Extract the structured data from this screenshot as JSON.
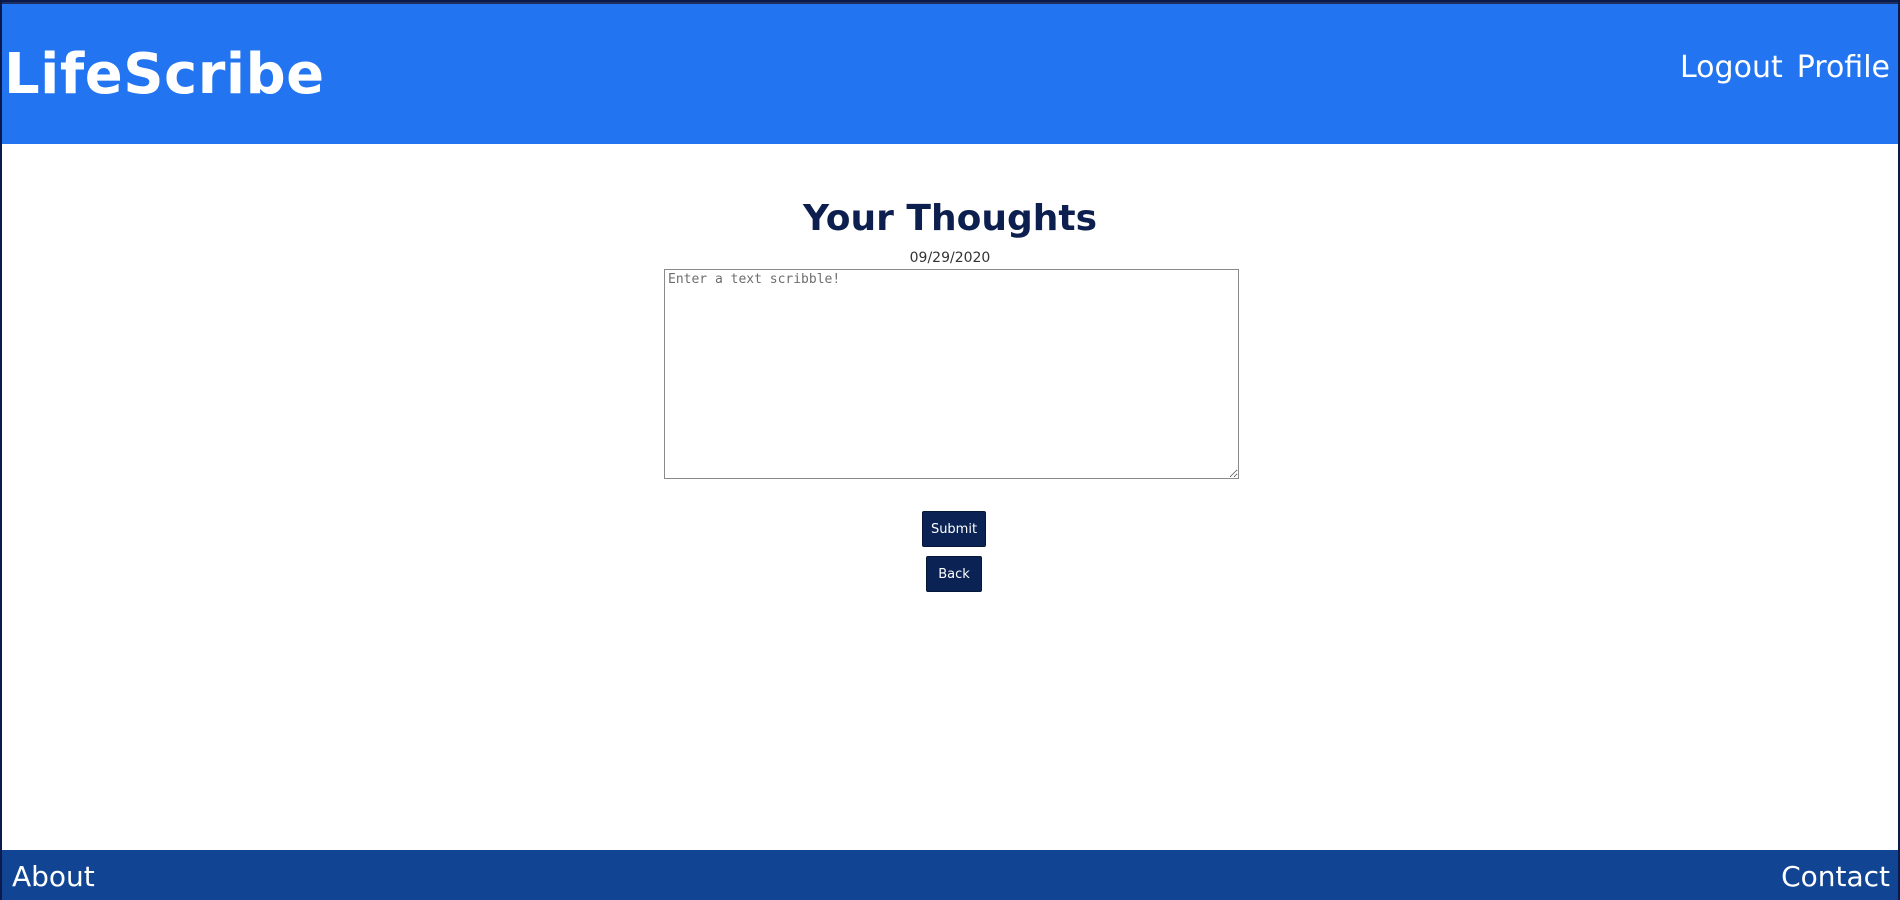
{
  "header": {
    "brand": "LifeScribe",
    "nav": {
      "logout": "Logout",
      "profile": "Profile"
    }
  },
  "main": {
    "title": "Your Thoughts",
    "date": "09/29/2020",
    "scribble": {
      "value": "",
      "placeholder": "Enter a text scribble!"
    },
    "submit_label": "Submit",
    "back_label": "Back"
  },
  "footer": {
    "about": "About",
    "contact": "Contact"
  },
  "colors": {
    "header_bg": "#2274f0",
    "footer_bg": "#114594",
    "button_bg": "#0a2354",
    "title_text": "#0d1f4f"
  }
}
